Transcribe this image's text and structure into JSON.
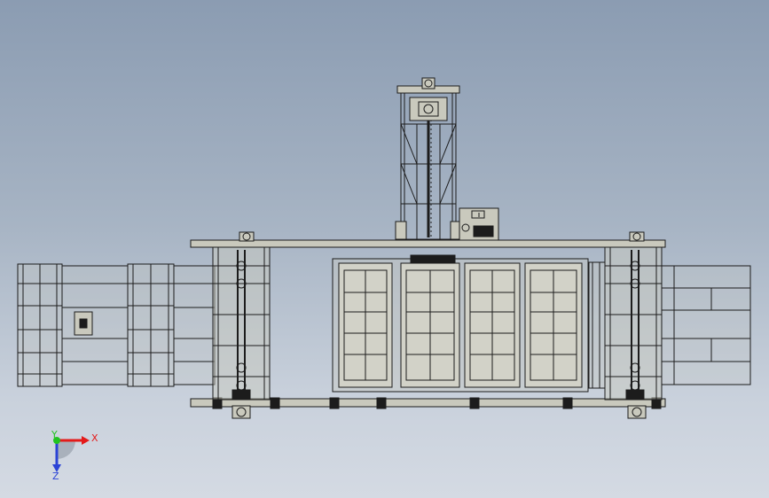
{
  "viewport": {
    "background_top": "#8b9cb2",
    "background_bottom": "#d4dae3"
  },
  "model": {
    "line_color": "#1c1c1c",
    "fill_color": "#c9c9bd",
    "glass_color": "#d2d2c8"
  },
  "triad": {
    "x_label": "X",
    "y_label": "Y",
    "z_label": "Z",
    "x_color": "#e41a1a",
    "y_color": "#21c321",
    "z_color": "#2b43d6"
  }
}
